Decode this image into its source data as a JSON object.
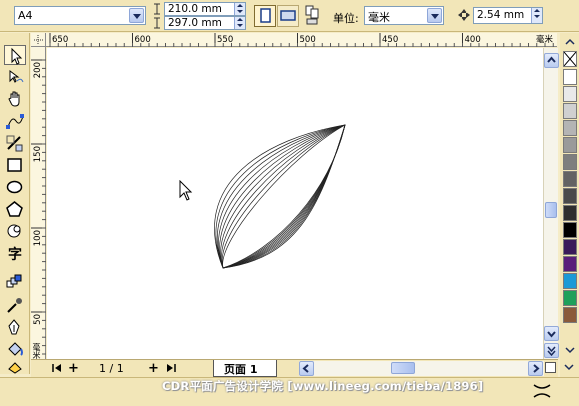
{
  "property_bar": {
    "page_size": "A4",
    "width": "210.0 mm",
    "height": "297.0 mm",
    "units_label": "单位:",
    "units_value": "毫米",
    "nudge": "2.54 mm"
  },
  "rulers": {
    "horizontal_ticks": [
      "650",
      "600",
      "550",
      "500",
      "450",
      "400"
    ],
    "horizontal_unit": "毫米",
    "vertical_ticks": [
      "200",
      "150",
      "100",
      "50"
    ],
    "vertical_unit": "毫米"
  },
  "toolbox": {
    "tools": [
      "pick-tool",
      "shape-tool",
      "pan-tool",
      "freehand-tool",
      "smart-fill-tool",
      "rectangle-tool",
      "ellipse-tool",
      "polygon-tool",
      "basic-shapes-tool",
      "text-tool",
      "interactive-blend-tool",
      "eyedropper-tool",
      "outline-tool",
      "fill-tool"
    ]
  },
  "page_nav": {
    "counter": "1 / 1",
    "tab_label": "页面 1"
  },
  "palette": {
    "colors": [
      "#ffffff",
      "#e9e9e9",
      "#d0d0d0",
      "#b4b4b4",
      "#9a9a9a",
      "#7e7e7e",
      "#636363",
      "#4a4a4a",
      "#2e2e2e",
      "#000000",
      "#3a1a5a",
      "#5a1e7a",
      "#1b9ad6",
      "#1ea05a",
      "#8a5a3a"
    ]
  },
  "watermark": "CDR平面广告设计学院      [www.lineeg.com/tieba/1896]"
}
